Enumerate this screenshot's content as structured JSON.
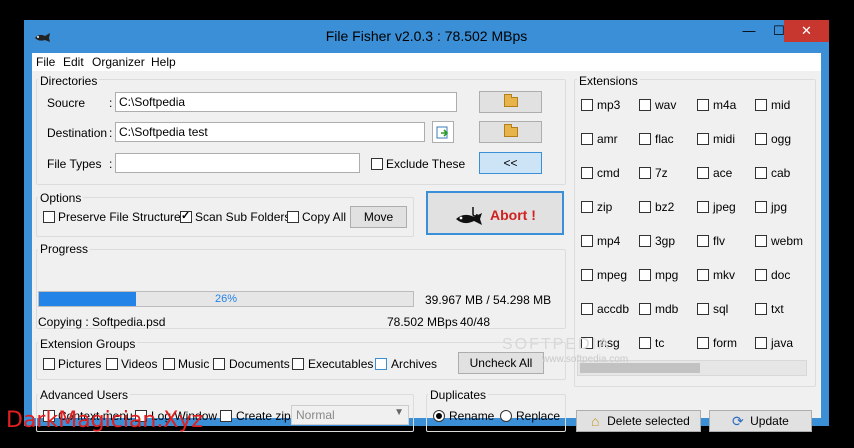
{
  "window": {
    "title": "File Fisher v2.0.3 : 78.502 MBps",
    "min_glyph": "—",
    "max_glyph": "☐",
    "close_glyph": "✕"
  },
  "menu": [
    "File",
    "Edit",
    "Organizer",
    "Help"
  ],
  "directories": {
    "title": "Directories",
    "source_label": "Soucre",
    "source_value": "C:\\Softpedia",
    "destination_label": "Destination",
    "destination_value": "C:\\Softpedia test",
    "filetypes_label": "File Types",
    "filetypes_value": "",
    "colon": ":",
    "exclude_label": "Exclude These",
    "collapse_label": "<<"
  },
  "options": {
    "title": "Options",
    "preserve_label": "Preserve File Structure",
    "preserve_checked": false,
    "scan_sub_label": "Scan Sub Folders",
    "scan_sub_checked": true,
    "copy_all_label": "Copy All",
    "copy_all_checked": false,
    "move_label": "Move"
  },
  "abort": {
    "label": "Abort !"
  },
  "progress": {
    "title": "Progress",
    "percent_text": "26%",
    "percent_value": 26,
    "size_text": "39.967 MB / 54.298 MB",
    "status_text": "Copying : Softpedia.psd",
    "speed_text": "78.502 MBps",
    "count_text": "40/48"
  },
  "extension_groups": {
    "title": "Extension Groups",
    "items": [
      {
        "label": "Pictures",
        "checked": false
      },
      {
        "label": "Videos",
        "checked": false
      },
      {
        "label": "Music",
        "checked": false
      },
      {
        "label": "Documents",
        "checked": false
      },
      {
        "label": "Executables",
        "checked": false
      },
      {
        "label": "Archives",
        "checked": false
      }
    ],
    "uncheck_all_label": "Uncheck All"
  },
  "advanced_users": {
    "title": "Advanced Users",
    "context_menu_label": "Context menu",
    "log_window_label": "Log Window",
    "create_zip_label": "Create zip",
    "compression_value": "Normal"
  },
  "duplicates": {
    "title": "Duplicates",
    "rename_label": "Rename",
    "replace_label": "Replace",
    "selected": "Rename"
  },
  "extensions": {
    "title": "Extensions",
    "items": [
      "mp3",
      "wav",
      "m4a",
      "mid",
      "amr",
      "flac",
      "midi",
      "ogg",
      "cmd",
      "7z",
      "ace",
      "cab",
      "zip",
      "bz2",
      "jpeg",
      "jpg",
      "mp4",
      "3gp",
      "flv",
      "webm",
      "mpeg",
      "mpg",
      "mkv",
      "doc",
      "accdb",
      "mdb",
      "sql",
      "txt",
      "msg",
      "tc",
      "form",
      "java"
    ],
    "delete_label": "Delete selected",
    "update_label": "Update"
  },
  "overlay": {
    "softpedia_watermark": "SOFTPEDIA",
    "softpedia_url": "www.softpedia.com",
    "site_watermark": "DarkMagician.Xyz"
  }
}
